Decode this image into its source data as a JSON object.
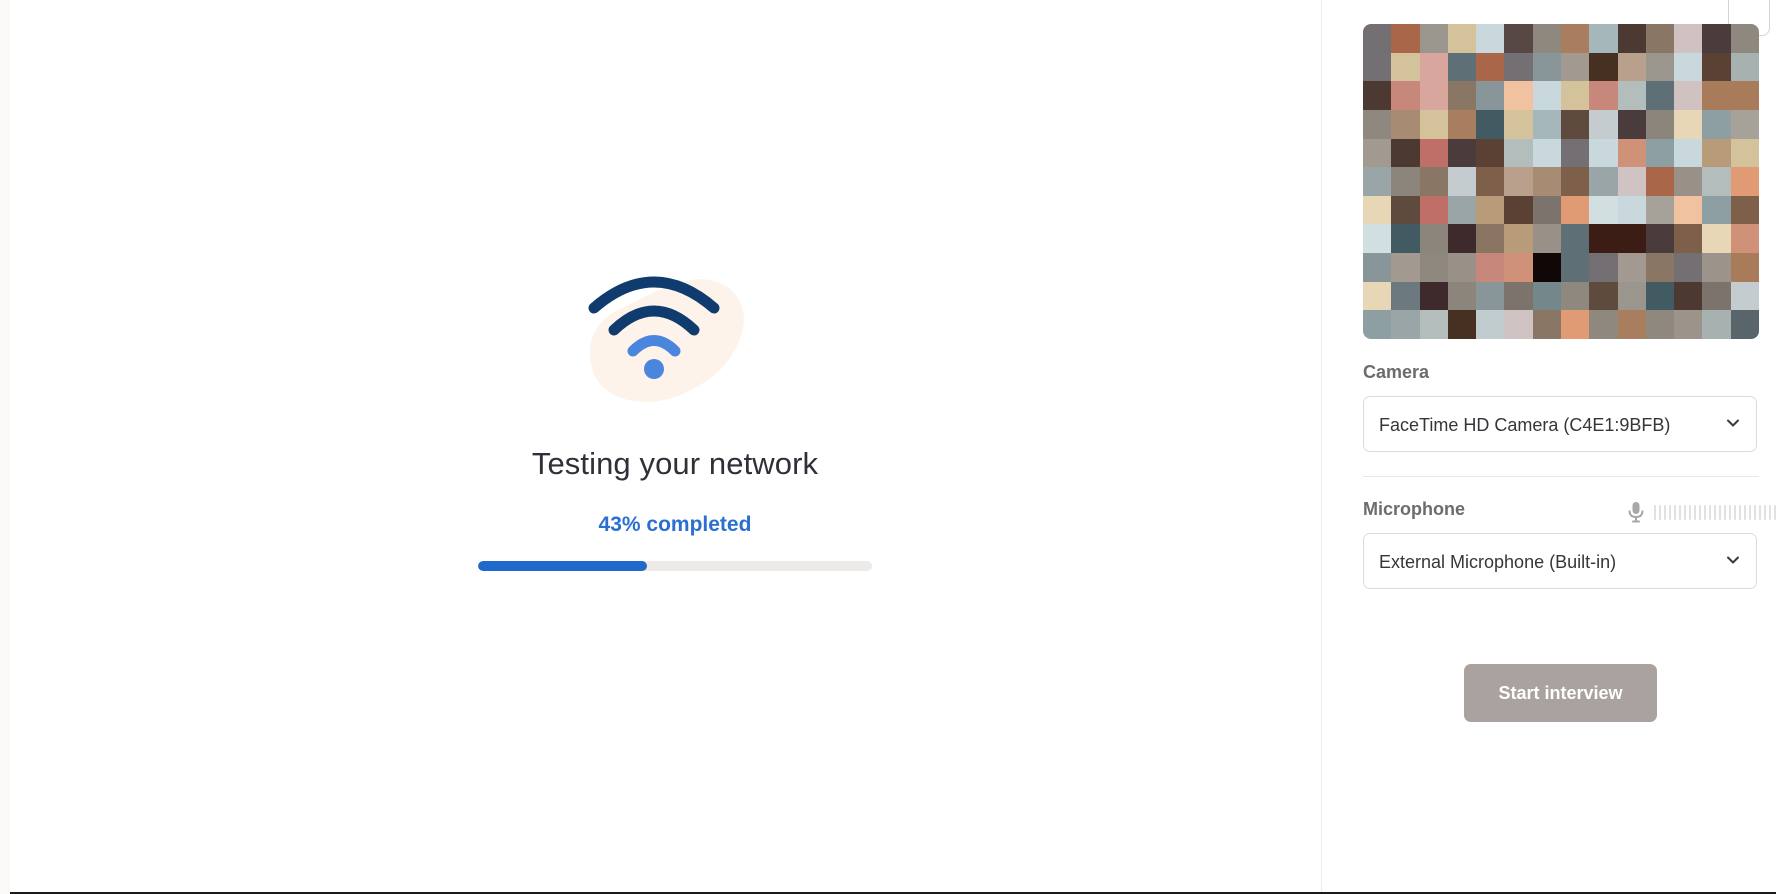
{
  "network_test": {
    "title": "Testing your network",
    "progress_text": "43% completed",
    "progress_fraction": 0.43,
    "icon": "wifi-icon",
    "colors": {
      "accent": "#2a6fd1",
      "progress_fill": "#2068c9",
      "progress_track": "#edeae7",
      "wifi_dark": "#0f3b6e",
      "wifi_light": "#4a86dd",
      "blob": "#fdf3ea"
    }
  },
  "devices": {
    "camera": {
      "label": "Camera",
      "selected": "FaceTime HD Camera (C4E1:9BFB)",
      "icon": "chevron-down-icon"
    },
    "microphone": {
      "label": "Microphone",
      "selected": "External Microphone (Built-in)",
      "level_icon": "microphone-icon",
      "icon": "chevron-down-icon"
    }
  },
  "actions": {
    "start_label": "Start interview",
    "start_color": "#aaa29f"
  }
}
